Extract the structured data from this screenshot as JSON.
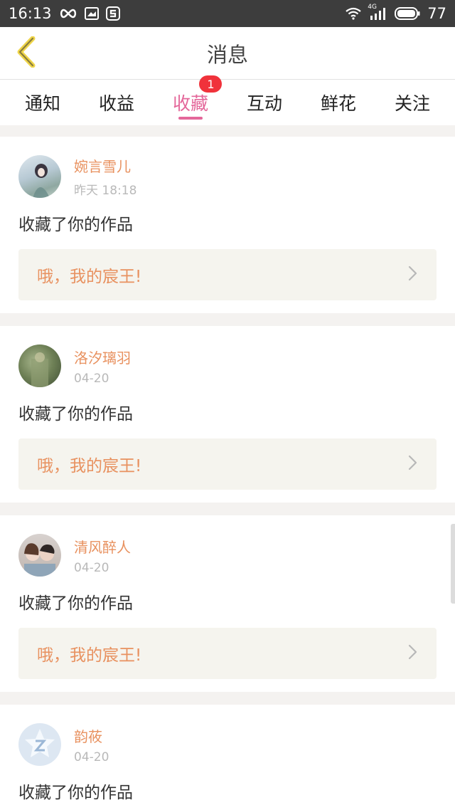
{
  "status_bar": {
    "time": "16:13",
    "network": "4G",
    "battery": "77",
    "icons": [
      "infinity-icon",
      "mail-card-icon",
      "s-app-icon",
      "wifi-icon",
      "signal-icon",
      "battery-icon"
    ]
  },
  "header": {
    "title": "消息"
  },
  "tabs": [
    {
      "label": "通知"
    },
    {
      "label": "收益"
    },
    {
      "label": "收藏",
      "badge": "1"
    },
    {
      "label": "互动"
    },
    {
      "label": "鲜花"
    },
    {
      "label": "关注"
    }
  ],
  "active_tab": "收藏",
  "accent_color": "#e4679a",
  "name_color": "#e8915f",
  "messages": [
    {
      "name": "婉言雪儿",
      "time": "昨天 18:18",
      "action": "收藏了你的作品",
      "work": "哦，我的宸王!"
    },
    {
      "name": "洛汐璃羽",
      "time": "04-20",
      "action": "收藏了你的作品",
      "work": "哦，我的宸王!"
    },
    {
      "name": "清风醉人",
      "time": "04-20",
      "action": "收藏了你的作品",
      "work": "哦，我的宸王!"
    },
    {
      "name": "韵莜",
      "time": "04-20",
      "action": "收藏了你的作品"
    }
  ]
}
